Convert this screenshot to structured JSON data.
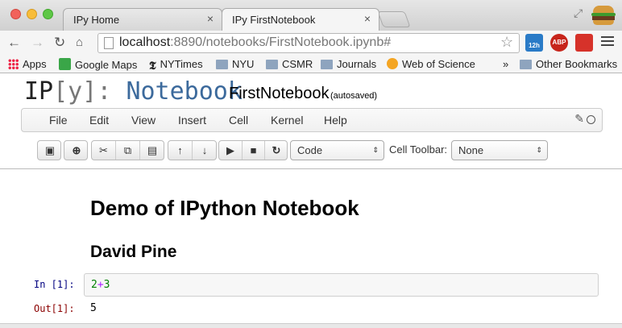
{
  "browser": {
    "tabs": [
      {
        "label": "IPy Home",
        "close": "×"
      },
      {
        "label": "IPy FirstNotebook",
        "close": "×"
      }
    ],
    "url_host": "localhost",
    "url_rest": ":8890/notebooks/FirstNotebook.ipynb#",
    "ext_calendar": "12h",
    "ext_abp": "ABP",
    "bookmarks": [
      "Apps",
      "Google Maps",
      "NYTimes",
      "NYU",
      "CSMR",
      "Journals",
      "Web of Science"
    ],
    "overflow": "»",
    "other_bookmarks": "Other Bookmarks"
  },
  "notebook": {
    "logo": {
      "ip": "IP",
      "y": "[y]",
      "colon": ":",
      "nb": "Notebook"
    },
    "name": "FirstNotebook",
    "status": "(autosaved)",
    "menu": [
      "File",
      "Edit",
      "View",
      "Insert",
      "Cell",
      "Kernel",
      "Help"
    ],
    "cell_type": "Code",
    "cell_toolbar_label": "Cell Toolbar:",
    "cell_toolbar_value": "None"
  },
  "cells": {
    "heading1": "Demo of IPython Notebook",
    "heading2": "David Pine",
    "in_prompt": "In [1]:",
    "code": {
      "a": "2",
      "op": "+",
      "b": "3"
    },
    "out_prompt": "Out[1]:",
    "output": "5"
  },
  "icons": [
    "back-icon",
    "forward-icon",
    "reload-icon",
    "home-icon",
    "page-icon",
    "star-icon",
    "save-icon",
    "insert-cell-icon",
    "cut-icon",
    "copy-icon",
    "paste-icon",
    "move-up-icon",
    "move-down-icon",
    "run-icon",
    "stop-icon",
    "restart-icon",
    "pencil-icon",
    "kernel-status-icon"
  ],
  "colors": {
    "accent": "#3c6a9c",
    "in_prompt": "#000080",
    "out_prompt": "#8b0000",
    "number": "#008000",
    "operator": "#aa22ff"
  }
}
